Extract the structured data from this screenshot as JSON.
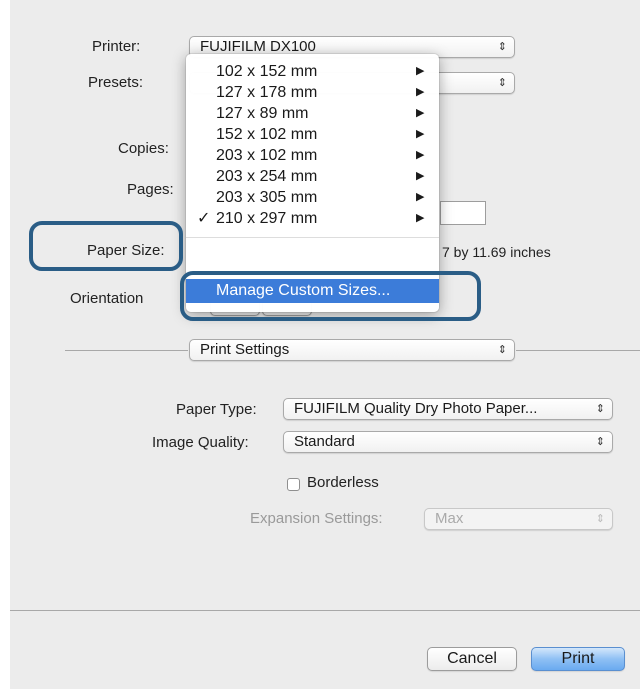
{
  "printer": {
    "label": "Printer:",
    "value": "FUJIFILM DX100"
  },
  "presets": {
    "label": "Presets:"
  },
  "copies": {
    "label": "Copies:"
  },
  "pages": {
    "label": "Pages:"
  },
  "paper_size": {
    "label": "Paper Size:",
    "dimension_text": "7 by 11.69 inches"
  },
  "orientation": {
    "label": "Orientation"
  },
  "paper_menu": {
    "items": [
      {
        "label": "102 x 152 mm"
      },
      {
        "label": "127 x 178 mm"
      },
      {
        "label": "127 x 89 mm"
      },
      {
        "label": "152 x 102 mm"
      },
      {
        "label": "203 x 102 mm"
      },
      {
        "label": "203 x 254 mm"
      },
      {
        "label": "203 x 305 mm"
      },
      {
        "label": "210 x 297 mm",
        "checked": true
      }
    ],
    "checkmark": "✓",
    "submenu_glyph": "▶",
    "manage_label": "Manage Custom Sizes..."
  },
  "section": {
    "value": "Print Settings"
  },
  "paper_type": {
    "label": "Paper Type:",
    "value": "FUJIFILM Quality Dry Photo Paper..."
  },
  "image_quality": {
    "label": "Image Quality:",
    "value": "Standard"
  },
  "borderless": {
    "label": "Borderless",
    "checked": false
  },
  "expansion": {
    "label": "Expansion Settings:",
    "value": "Max",
    "disabled": true
  },
  "buttons": {
    "cancel": "Cancel",
    "print": "Print"
  },
  "popup_arrows": "⇕",
  "colors": {
    "highlight": "#3c7cd9",
    "callout": "#2a5d86",
    "dialog_bg": "#ececec"
  }
}
